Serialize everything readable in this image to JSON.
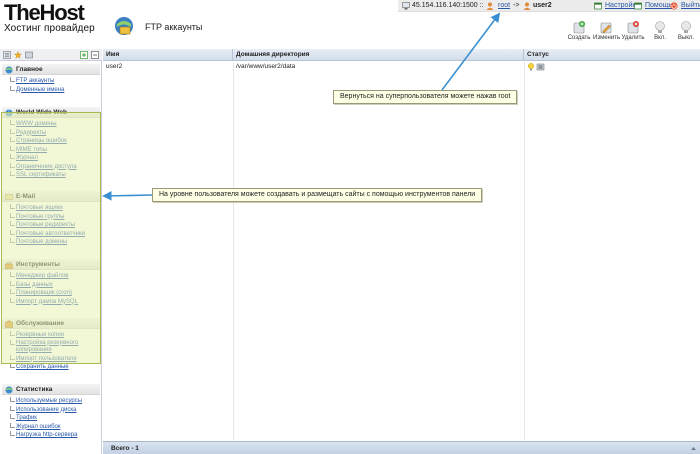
{
  "brand": {
    "logo_main": "TheHost",
    "logo_sub": "Хостинг провайдер"
  },
  "page": {
    "title": "FTP аккаунты"
  },
  "topbar": {
    "address": "45.154.116.140:1500 ::",
    "root_user": "root",
    "arrow": "->",
    "current_user": "user2",
    "settings": "Настройки",
    "help": "Помощь",
    "logout": "Выйти"
  },
  "toolbar": [
    {
      "label": "Создать",
      "icon": "create-icon"
    },
    {
      "label": "Изменить",
      "icon": "edit-icon"
    },
    {
      "label": "Удалить",
      "icon": "delete-icon"
    },
    {
      "label": "Вкл.",
      "icon": "enable-icon"
    },
    {
      "label": "Выкл.",
      "icon": "disable-icon"
    }
  ],
  "sidebar": {
    "sections": [
      {
        "title": "Главное",
        "items": [
          "FTP аккаунты",
          "Доменные имена"
        ]
      },
      {
        "title": "World Wide Web",
        "items": [
          "WWW домены",
          "Редиректы",
          "Страницы ошибок",
          "MIME типы",
          "Журнал",
          "Ограничение доступа",
          "SSL сертификаты"
        ]
      },
      {
        "title": "E-Mail",
        "items": [
          "Почтовые ящики",
          "Почтовые группы",
          "Почтовые редиректы",
          "Почтовые автоответчики",
          "Почтовые домены"
        ]
      },
      {
        "title": "Инструменты",
        "items": [
          "Менеджер файлов",
          "Базы данных",
          "Планировщик (cron)",
          "Импорт дампа MySQL"
        ]
      },
      {
        "title": "Обслуживание",
        "items": [
          "Резервные копии",
          "Настройка резервного копирования",
          "Импорт пользователя",
          "Сохранить данные"
        ]
      },
      {
        "title": "Статистика",
        "items": [
          "Используемые ресурсы",
          "Использование диска",
          "Трафик",
          "Журнал ошибок",
          "Нагрузка http-сервера"
        ]
      }
    ]
  },
  "table": {
    "columns": [
      "Имя",
      "Домашняя директория",
      "Статус"
    ],
    "rows": [
      {
        "name": "user2",
        "home": "/var/www/user2/data"
      }
    ],
    "footer": "Всего - 1"
  },
  "callouts": {
    "root_hint": "Вернуться на суперпользователя можете нажав root",
    "panel_hint": "На уровне пользователя можете создавать и размещать сайты с помощью инструментов панели"
  },
  "colors": {
    "link": "#2a58a8",
    "highlight_border": "#a9b94f",
    "arrow": "#3a8fd0",
    "header_bg": "#d2dceb"
  }
}
